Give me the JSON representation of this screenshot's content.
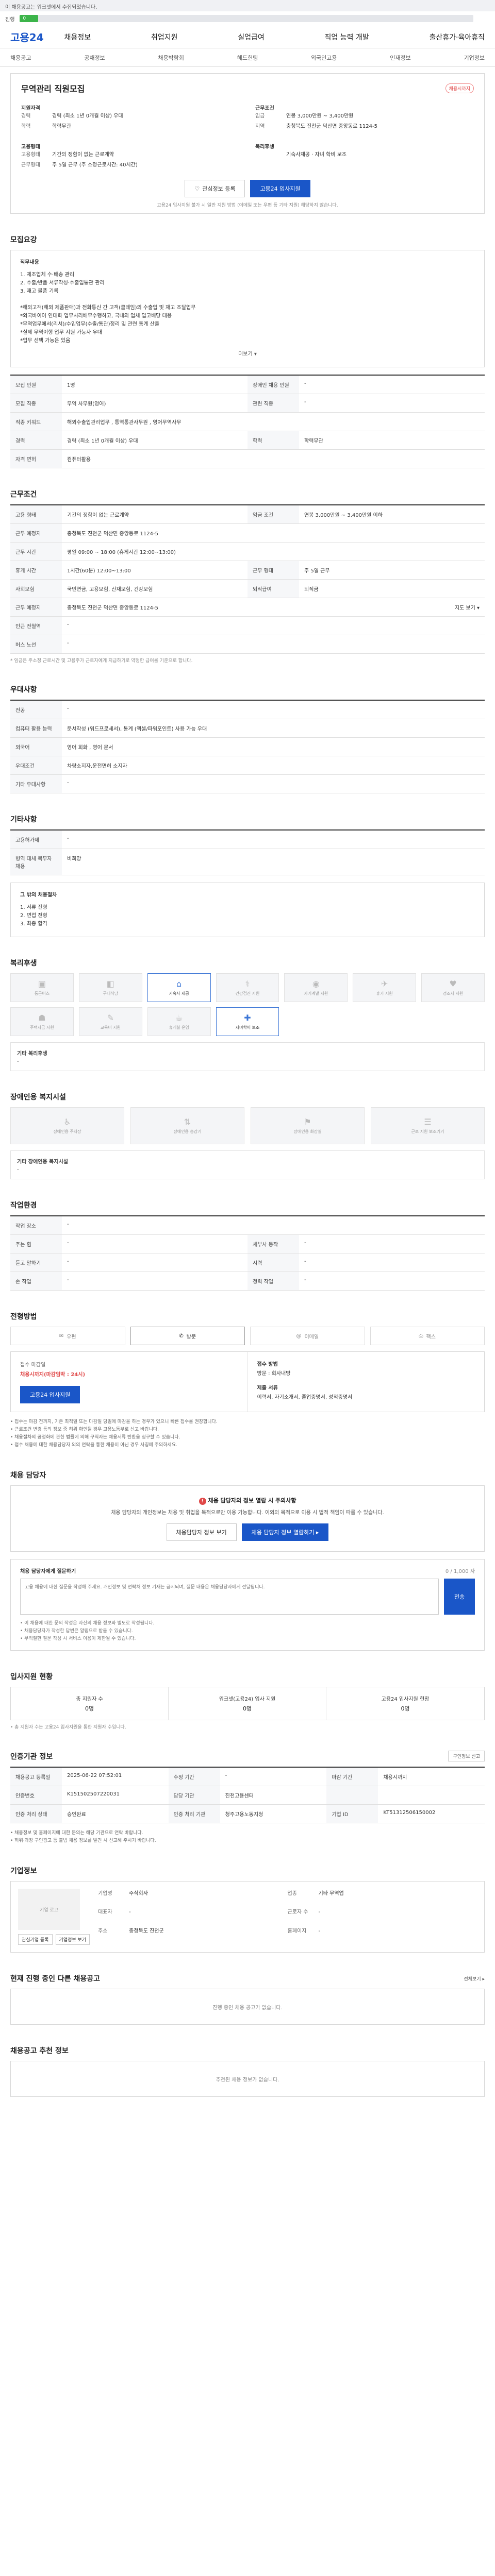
{
  "banner": {
    "text": "이 채용공고는 워크넷에서 수집되었습니다."
  },
  "progress": {
    "label": "진행",
    "percent": 4,
    "num": "0"
  },
  "header": {
    "logo": "고용24",
    "nav": [
      "채용정보",
      "취업지원",
      "실업급여",
      "직업 능력 개발",
      "출산휴가·육아휴직"
    ]
  },
  "subnav": [
    "채용공고",
    "공채정보",
    "채용박람회",
    "헤드헌팅",
    "외국인고용",
    "인재정보",
    "기업정보"
  ],
  "job": {
    "status": "채용시까지",
    "title": "무역관리 직원모집",
    "summary_left_title": "지원자격",
    "summary_left": [
      {
        "k": "경력",
        "v": "경력 (최소 1년 0개월 이상) 우대"
      },
      {
        "k": "학력",
        "v": "학력무관"
      }
    ],
    "summary_right_title": "근무조건",
    "summary_right": [
      {
        "k": "임금",
        "v": "연봉 3,000만원 ~ 3,400만원"
      },
      {
        "k": "지역",
        "v": "충청북도 진천군 덕산면 중앙동로 1124-5"
      }
    ],
    "form_left_title": "고용형태",
    "form_left": [
      {
        "k": "고용형태",
        "v": "기간의 정함이 없는 근로계약"
      },
      {
        "k": "근무형태",
        "v": "주 5일 근무 (주 소정근로시간: 40시간)"
      }
    ],
    "form_right_title": "복리후생",
    "form_right": [
      {
        "k": "",
        "v": "기숙사제공 · 자녀 학비 보조"
      }
    ],
    "btn_save": "관심정보 등록",
    "btn_apply": "고용24 입사지원",
    "notice": "고용24 입사지원 불가 시 일반 지원 방법 (이메일 또는 우편 등 기타 지원) 해당하지 않습니다."
  },
  "recruit": {
    "head": "모집요강",
    "desc_title": "직무내용",
    "desc_lines": [
      "1. 제조업체 수·배송 관리",
      "2. 수출/반품 서류작성·수출입통관 관리",
      "3. 재고 물품 기록",
      "",
      "*해외고객(해외 제품판매)과 전화통신 간 고객(클레임)의 수출입 및 재고 조달업무",
      "*외국바이어 인대화 업무처리배무수행하고, 국내외 업체 입고배당 대응",
      "*무역업무에서(리서)/수입업무(수출/통관)정리 및 관련 통계 산출",
      "*실제 무역이행 업무 지원 가능자 우대",
      "*업무 선택 가능은 있음"
    ],
    "more": "더보기 ▾",
    "rows": [
      {
        "k": "모집 인원",
        "v": "1명",
        "k2": "장애인 채용 인원",
        "v2": "-"
      },
      {
        "k": "모집 직종",
        "v": "무역 사무원(영어)",
        "k2": "관련 직종",
        "v2": "-"
      },
      {
        "k": "직종 키워드",
        "v": "해외수출입관리업무 , 통역통관사무원 , 영어무역사무",
        "k2": "",
        "v2": ""
      },
      {
        "k": "경력",
        "v": "경력 (최소 1년 0개월 이상) 우대",
        "k2": "학력",
        "v2": "학력무관"
      },
      {
        "k": "자격 면허",
        "v": "컴퓨터활용",
        "k2": "",
        "v2": ""
      }
    ]
  },
  "conditions": {
    "head": "근무조건",
    "rows": [
      {
        "k": "고용 형태",
        "v": "기간의 정함이 없는 근로계약",
        "k2": "임금 조건",
        "v2": "연봉 3,000만원 ~ 3,400만원 이하"
      },
      {
        "k": "근무 예정지",
        "v": "충청북도 진천군 덕산면 중앙동로 1124-5",
        "k2": "",
        "v2": ""
      },
      {
        "k": "근무 시간",
        "v": "평일 09:00 ~ 18:00 (휴게시간 12:00~13:00)",
        "k2": "",
        "v2": ""
      },
      {
        "k": "휴게 시간",
        "v": "1시간(60분) 12:00~13:00",
        "k2": "근무 형태",
        "v2": "주 5일 근무"
      },
      {
        "k": "사회보험",
        "v": "국민연금, 고용보험, 산재보험, 건강보험",
        "k2": "퇴직급여",
        "v2": "퇴직금"
      },
      {
        "k": "근무 예정지",
        "v": "충청북도 진천군 덕산면 중앙동로 1124-5",
        "k2": "",
        "v2": "지도 보기 ▾"
      },
      {
        "k": "인근 전철역",
        "v": "-",
        "k2": "",
        "v2": ""
      },
      {
        "k": "버스 노선",
        "v": "-",
        "k2": "",
        "v2": ""
      }
    ],
    "note": "* 임금은 주소정 근로시간 및 고용주가 근로자에게 지급하기로 약정한 급여를 기준으로 합니다."
  },
  "preference": {
    "head": "우대사항",
    "rows": [
      {
        "k": "전공",
        "v": "-"
      },
      {
        "k": "컴퓨터 활용 능력",
        "v": "문서작성 (워드프로세서), 통계 (엑셀/파워포인트) 사용 가능 우대"
      },
      {
        "k": "외국어",
        "v": "영어 회화 , 영어 문서"
      },
      {
        "k": "우대조건",
        "v": "차량소지자,운전면허 소지자"
      },
      {
        "k": "기타 우대사항",
        "v": "-"
      }
    ]
  },
  "etc": {
    "head": "기타사항",
    "rows": [
      {
        "k": "고용허가제",
        "v": "-"
      },
      {
        "k": "병역 대체 복무자 채용",
        "v": "비희망"
      }
    ]
  },
  "process": {
    "head_line": "그 밖의 채용절차",
    "lines": [
      "1. 서류 전형",
      "2. 면접 전형",
      "3. 최종 합격"
    ]
  },
  "welfare": {
    "head": "복리후생",
    "items": [
      {
        "icon": "▣",
        "label": "통근버스",
        "on": false
      },
      {
        "icon": "◧",
        "label": "구내식당",
        "on": false
      },
      {
        "icon": "⌂",
        "label": "기숙사 제공",
        "on": true
      },
      {
        "icon": "⚕",
        "label": "건강검진 지원",
        "on": false
      },
      {
        "icon": "◉",
        "label": "자기계발 지원",
        "on": false
      },
      {
        "icon": "✈",
        "label": "휴가 지원",
        "on": false
      },
      {
        "icon": "♥",
        "label": "경조사 지원",
        "on": false
      },
      {
        "icon": "☗",
        "label": "주택자금 지원",
        "on": false
      },
      {
        "icon": "✎",
        "label": "교육비 지원",
        "on": false
      },
      {
        "icon": "☕",
        "label": "휴게실 운영",
        "on": false
      },
      {
        "icon": "✚",
        "label": "자녀학비 보조",
        "on": true
      }
    ],
    "free_label": "기타 복리후생",
    "free_value": "-"
  },
  "disability": {
    "head": "장애인용 복지시설",
    "items": [
      {
        "icon": "♿",
        "label": "장애인용 주차장"
      },
      {
        "icon": "⇅",
        "label": "장애인용 승강기"
      },
      {
        "icon": "⚑",
        "label": "장애인용 화장실"
      },
      {
        "icon": "☰",
        "label": "근로 지원 보조기기"
      }
    ],
    "free_label": "기타 장애인용 복지시설",
    "free_value": "-"
  },
  "workenv": {
    "head": "작업환경",
    "rows": [
      {
        "k": "작업 장소",
        "v": "-",
        "k2": "",
        "v2": ""
      },
      {
        "k": "주는 힘",
        "v": "-",
        "k2": "세부사 동작",
        "v2": "-"
      },
      {
        "k": "듣고 말하기",
        "v": "-",
        "k2": "시력",
        "v2": "-"
      },
      {
        "k": "손 작업",
        "v": "-",
        "k2": "청력 작업",
        "v2": "-"
      }
    ]
  },
  "apply": {
    "head": "전형방법",
    "methods": [
      {
        "icon": "✉",
        "label": "우편",
        "on": false
      },
      {
        "icon": "✆",
        "label": "방문",
        "on": true
      },
      {
        "icon": "@",
        "label": "이메일",
        "on": false
      },
      {
        "icon": "⎙",
        "label": "팩스",
        "on": false
      }
    ],
    "deadline_label": "접수 마감일",
    "deadline": "채용시까지(마감임박 : 24시)",
    "apply_btn": "고용24 입사지원",
    "right": [
      "접수 방법",
      "방문 : 회사내방",
      "",
      "제출 서류",
      "이력서, 자기소개서, 졸업증명서, 성적증명서"
    ],
    "bullets": [
      "• 접수는 마감 전까지, 기존 최적일 또는 마감일 당일에 마감을 하는 경우가 있으니 빠른 접수를 권장합니다.",
      "• 근로조건 변경 등의 정보 중 허위 확인될 경우 고용노동부로 신고 바랍니다.",
      "• 채용절차의 공정화에 관한 법률에 의해 구직자는 채용서류 반환을 청구할 수 있습니다.",
      "• 접수 채용에 대한 채용담당자 외의 연락을 통한 채용이 아닌 경우 사칭에 주의하세요."
    ]
  },
  "manager": {
    "head": "채용 담당자",
    "alert_title": "채용 담당자의 정보 열람 시 주의사항",
    "alert_desc": "채용 담당자의 개인정보는 채용 및 취업을 목적으로만 이용 가능합니다. 이외의 목적으로 이용 시 법적 책임이 따를 수 있습니다.",
    "btn_view": "채용담당자 정보 보기",
    "btn_more": "채용 담당자 정보 열람하기 ▸",
    "msg_title": "채용 담당자에게 질문하기",
    "msg_count": "0 / 1,000 자",
    "msg_placeholder": "고용 채용에 대한 질문을 작성해 주세요. 개인정보 및 연락처 정보 기재는 금지되며, 질문 내용은 채용담당자에게 전달됩니다.",
    "send": "전송",
    "notes": [
      "• 이 채용에 대한 문의 작성은 자신의 채용 정보와 별도로 작성됩니다.",
      "• 채용담당자가 작성한 답변은 알림으로 받을 수 있습니다.",
      "• 부적절한 질문 작성 시 서비스 이용이 제한될 수 있습니다."
    ]
  },
  "insurance": {
    "head": "입사지원 현황",
    "cells": [
      {
        "label": "총 지원자 수",
        "value": "0명"
      },
      {
        "label": "워크넷(고용24) 입사 지원",
        "value": "0명"
      },
      {
        "label": "고용24 입사지원 현황",
        "value": "0명"
      }
    ],
    "note": "• 총 지원자 수는 고용24 입사지원을 통한 지원자 수입니다."
  },
  "posting": {
    "head": "인증기관 정보",
    "right": "구인정보 신고",
    "rows": [
      {
        "k": "채용공고 등록일",
        "v": "2025-06-22 07:52:01",
        "k2": "수정 기간",
        "v2": "-",
        "k3": "마감 기간",
        "v3": "채용시까지"
      },
      {
        "k": "인증번호",
        "v": "K151502507220031",
        "k2": "담당 기관",
        "v2": "진천고용센터",
        "k3": "",
        "v3": ""
      },
      {
        "k": "인증 처리 상태",
        "v": "승인완료",
        "k2": "인증 처리 기관",
        "v2": "청주고용노동지청",
        "k3": "기업 ID",
        "v3": "KT51312506150002"
      }
    ],
    "notes": [
      "• 채용정보 및 홈페이지에 대한 문의는 해당 기관으로 연락 바랍니다.",
      "• 허위·과장 구인광고 등 불법 채용 정보를 발견 시 신고해 주시기 바랍니다."
    ]
  },
  "company": {
    "head": "기업정보",
    "logo": "기업 로고",
    "info": [
      {
        "k": "기업명",
        "v": "주식회사"
      },
      {
        "k": "업종",
        "v": "기타 무역업"
      },
      {
        "k": "대표자",
        "v": "-"
      },
      {
        "k": "근로자 수",
        "v": "-"
      },
      {
        "k": "주소",
        "v": "충청북도 진천군"
      },
      {
        "k": "홈페이지",
        "v": "-"
      }
    ],
    "btns": [
      "관심기업 등록",
      "기업정보 보기"
    ]
  },
  "other_jobs": {
    "head": "현재 진행 중인 다른 채용공고",
    "right": "전체보기 ▸",
    "empty": "진행 중인 채용 공고가 없습니다."
  },
  "recommend": {
    "head": "채용공고 추천 정보",
    "empty": "추천된 채용 정보가 없습니다."
  }
}
